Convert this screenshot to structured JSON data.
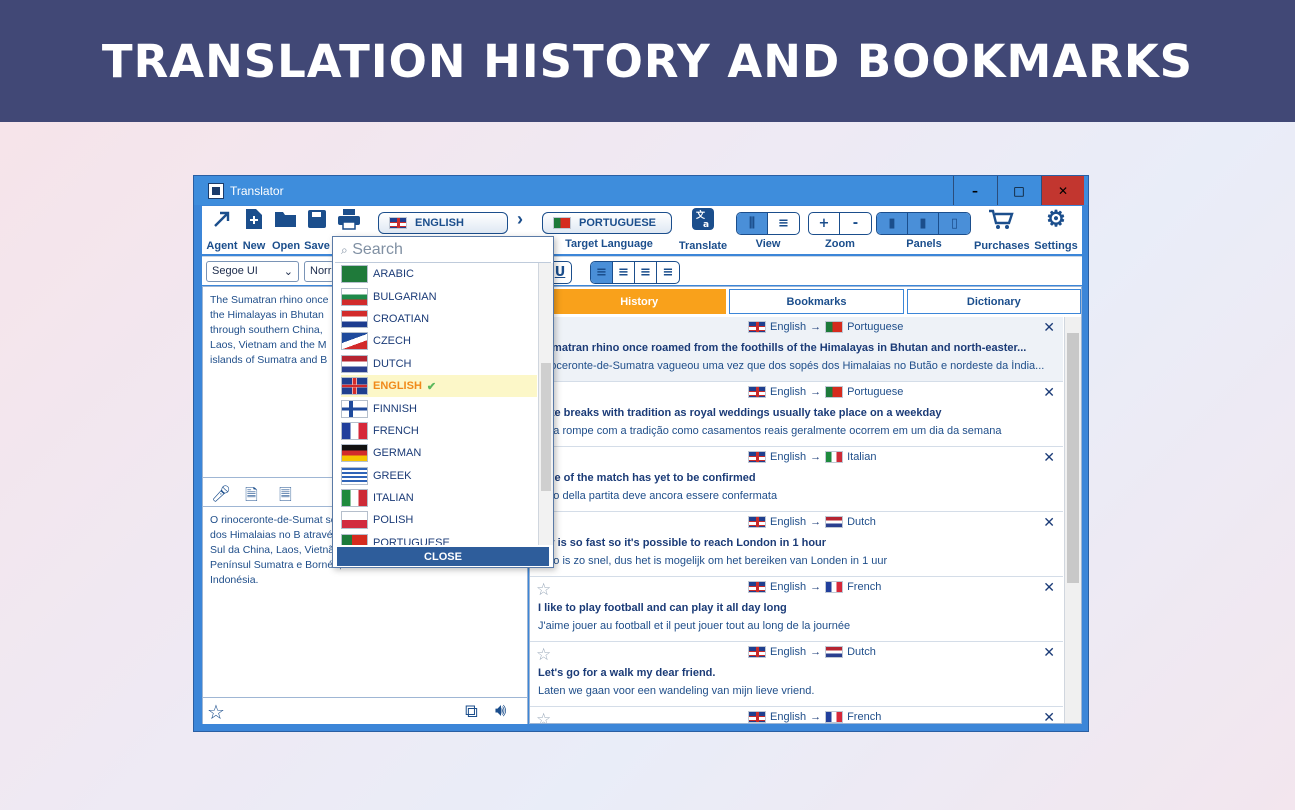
{
  "banner": {
    "title": "TRANSLATION HISTORY AND BOOKMARKS"
  },
  "window": {
    "title": "Translator",
    "min": "–",
    "max": "□",
    "close": "✕"
  },
  "toolbar": {
    "agent": "Agent",
    "new": "New",
    "open": "Open",
    "save": "Save",
    "source_lang": "ENGLISH",
    "target_lang": "PORTUGUESE",
    "target_caption": "Target Language",
    "translate": "Translate",
    "view": "View",
    "zoom": "Zoom",
    "panels": "Panels",
    "purchases": "Purchases",
    "settings": "Settings"
  },
  "format": {
    "font": "Segoe UI",
    "size": "Norr"
  },
  "source_text": "The Sumatran rhino once the Himalayas in Bhutan through southern China, Laos, Vietnam and the M islands of Sumatra and B",
  "target_text": "O rinoceronte-de-Sumat sopés dos Himalaias no B através do Sul da China, Laos, Vietnã e a Penínsul Sumatra e Bornéu, na Indonésia.",
  "tabs": [
    "History",
    "Bookmarks",
    "Dictionary"
  ],
  "history": [
    {
      "from": "English",
      "to": "Portuguese",
      "to_flag": "pt",
      "src": "Sumatran rhino once roamed from the foothills of the Himalayas in Bhutan and north-easter...",
      "tgt": "rinoceronte-de-Sumatra vagueou uma vez que dos sopés dos Himalaias no Butão e nordeste da Índia..."
    },
    {
      "from": "English",
      "to": "Portuguese",
      "to_flag": "pt",
      "src": "date breaks with tradition as royal weddings usually take place on a weekday",
      "tgt": "data rompe com a tradição como casamentos reais geralmente ocorrem em um dia da semana"
    },
    {
      "from": "English",
      "to": "Italian",
      "to_flag": "it",
      "src": "time of the match has yet to be confirmed",
      "tgt": "mpo della partita deve ancora essere confermata"
    },
    {
      "from": "English",
      "to": "Dutch",
      "to_flag": "nl",
      "src": "car is so fast so it's possible to reach London in 1 hour",
      "tgt": "auto is zo snel, dus het is mogelijk om het bereiken van Londen in 1 uur"
    },
    {
      "from": "English",
      "to": "French",
      "to_flag": "fr",
      "src": "I like to play football and can play it all day long",
      "tgt": "J'aime jouer au football et il peut jouer tout au long de la journée"
    },
    {
      "from": "English",
      "to": "Dutch",
      "to_flag": "nl",
      "src": "Let's go for a walk my dear friend.",
      "tgt": "Laten we gaan voor een wandeling van mijn lieve vriend."
    },
    {
      "from": "English",
      "to": "French",
      "to_flag": "fr",
      "src": "",
      "tgt": ""
    }
  ],
  "dropdown": {
    "search_placeholder": "Search",
    "close": "CLOSE",
    "languages": [
      "ARABIC",
      "BULGARIAN",
      "CROATIAN",
      "CZECH",
      "DUTCH",
      "ENGLISH",
      "FINNISH",
      "FRENCH",
      "GERMAN",
      "GREEK",
      "ITALIAN",
      "POLISH",
      "PORTUGUESE"
    ],
    "selected": "ENGLISH"
  },
  "colors": {
    "banner": "#414876",
    "window": "#3c86d8",
    "active_tab": "#f9a11b",
    "close_bg": "#c2362f"
  }
}
